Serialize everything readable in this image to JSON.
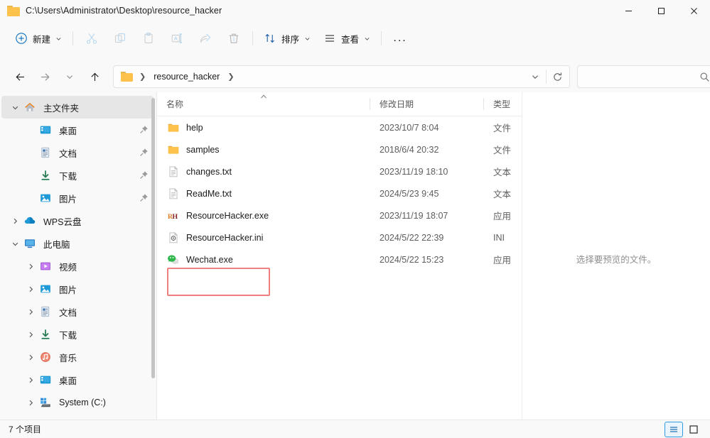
{
  "window": {
    "title": "C:\\Users\\Administrator\\Desktop\\resource_hacker",
    "minimize_label": "最小化",
    "maximize_label": "最大化",
    "close_label": "关闭"
  },
  "toolbar": {
    "new_label": "新建",
    "sort_label": "排序",
    "view_label": "查看",
    "more_label": "...",
    "cut_label": "剪切",
    "copy_label": "复制",
    "paste_label": "粘贴",
    "rename_label": "重命名",
    "share_label": "共享",
    "delete_label": "删除"
  },
  "address": {
    "back_label": "后退",
    "forward_label": "前进",
    "recent_label": "最近查看的位置",
    "up_label": "上移到上一级",
    "crumbs": [
      "resource_hacker"
    ],
    "dropdown_label": "历史记录",
    "refresh_label": "刷新",
    "search_value": "",
    "search_placeholder": ""
  },
  "sidebar": {
    "items": [
      {
        "label": "主文件夹",
        "icon": "home-icon",
        "twisty": "down",
        "level": 0,
        "selected": true,
        "pinned": false
      },
      {
        "label": "桌面",
        "icon": "desktop-icon",
        "twisty": "none",
        "level": 1,
        "selected": false,
        "pinned": true
      },
      {
        "label": "文档",
        "icon": "documents-icon",
        "twisty": "none",
        "level": 1,
        "selected": false,
        "pinned": true
      },
      {
        "label": "下载",
        "icon": "downloads-icon",
        "twisty": "none",
        "level": 1,
        "selected": false,
        "pinned": true
      },
      {
        "label": "图片",
        "icon": "pictures-icon",
        "twisty": "none",
        "level": 1,
        "selected": false,
        "pinned": true
      },
      {
        "label": "WPS云盘",
        "icon": "cloud-icon",
        "twisty": "right",
        "level": 0,
        "selected": false,
        "pinned": false
      },
      {
        "label": "此电脑",
        "icon": "thispc-icon",
        "twisty": "down",
        "level": 0,
        "selected": false,
        "pinned": false
      },
      {
        "label": "视频",
        "icon": "videos-icon",
        "twisty": "right",
        "level": 1,
        "selected": false,
        "pinned": false
      },
      {
        "label": "图片",
        "icon": "pictures-icon",
        "twisty": "right",
        "level": 1,
        "selected": false,
        "pinned": false
      },
      {
        "label": "文档",
        "icon": "documents-icon",
        "twisty": "right",
        "level": 1,
        "selected": false,
        "pinned": false
      },
      {
        "label": "下载",
        "icon": "downloads-icon",
        "twisty": "right",
        "level": 1,
        "selected": false,
        "pinned": false
      },
      {
        "label": "音乐",
        "icon": "music-icon",
        "twisty": "right",
        "level": 1,
        "selected": false,
        "pinned": false
      },
      {
        "label": "桌面",
        "icon": "desktop-icon",
        "twisty": "right",
        "level": 1,
        "selected": false,
        "pinned": false
      },
      {
        "label": "System (C:)",
        "icon": "drive-icon",
        "twisty": "right",
        "level": 1,
        "selected": false,
        "pinned": false
      }
    ]
  },
  "filelist": {
    "columns": [
      {
        "label": "名称",
        "sorted": "asc"
      },
      {
        "label": "修改日期",
        "sorted": ""
      },
      {
        "label": "类型",
        "sorted": ""
      }
    ],
    "rows": [
      {
        "name": "help",
        "date": "2023/10/7 8:04",
        "type": "文件",
        "icon": "folder-icon",
        "highlighted": false
      },
      {
        "name": "samples",
        "date": "2018/6/4 20:32",
        "type": "文件",
        "icon": "folder-icon",
        "highlighted": false
      },
      {
        "name": "changes.txt",
        "date": "2023/11/19 18:10",
        "type": "文本",
        "icon": "text-file-icon",
        "highlighted": false
      },
      {
        "name": "ReadMe.txt",
        "date": "2024/5/23 9:45",
        "type": "文本",
        "icon": "text-file-icon",
        "highlighted": false
      },
      {
        "name": "ResourceHacker.exe",
        "date": "2023/11/19 18:07",
        "type": "应用",
        "icon": "resource-hacker-icon",
        "highlighted": false
      },
      {
        "name": "ResourceHacker.ini",
        "date": "2024/5/22 22:39",
        "type": "INI",
        "icon": "ini-file-icon",
        "highlighted": false
      },
      {
        "name": "Wechat.exe",
        "date": "2024/5/22 15:23",
        "type": "应用",
        "icon": "wechat-icon",
        "highlighted": true
      }
    ]
  },
  "preview": {
    "empty_text": "选择要预览的文件。"
  },
  "statusbar": {
    "item_count": "7 个项目",
    "details_view_label": "详细信息",
    "large_icons_view_label": "大图标"
  },
  "colors": {
    "accent": "#0078d4",
    "highlight_box": "#f08080",
    "folder": "#fcc24c",
    "selection": "#e6e6e6"
  }
}
